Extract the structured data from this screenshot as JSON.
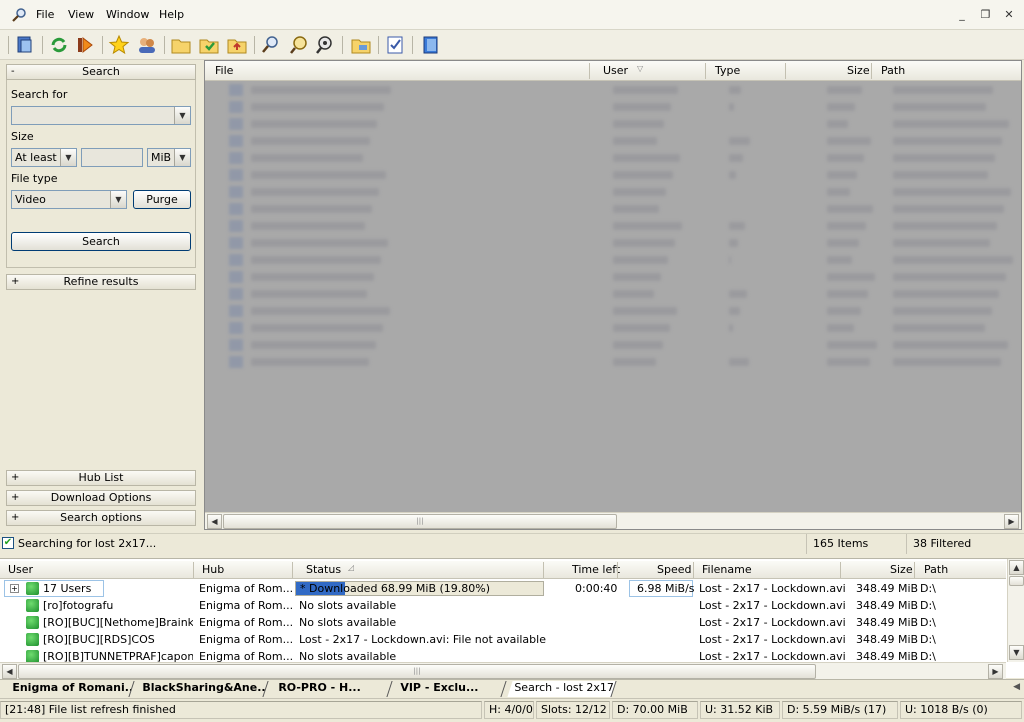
{
  "menu": {
    "items": [
      "File",
      "View",
      "Window",
      "Help"
    ]
  },
  "window_controls": {
    "minimize": "_",
    "restore": "❐",
    "close": "✕"
  },
  "left_panel": {
    "search_header": "Search",
    "search_for_label": "Search for",
    "search_for_value": "",
    "size_label": "Size",
    "size_mode": "At least",
    "size_value": "",
    "size_unit": "MiB",
    "file_type_label": "File type",
    "file_type_value": "Video",
    "purge_button": "Purge",
    "search_button": "Search",
    "refine_header": "Refine results",
    "hub_list_header": "Hub List",
    "download_options_header": "Download Options",
    "search_options_header": "Search options",
    "collapse_sign": "-",
    "expand_sign": "+"
  },
  "results": {
    "columns": [
      "File",
      "User",
      "Type",
      "Size",
      "Path"
    ],
    "row_count_visible": 17
  },
  "search_status": {
    "text": "Searching for lost 2x17...",
    "items": "165 Items",
    "filtered": "38 Filtered"
  },
  "queue": {
    "columns": [
      "User",
      "Hub",
      "Status",
      "Time left",
      "Speed",
      "Filename",
      "Size",
      "Path"
    ],
    "rows": [
      {
        "user": "17 Users",
        "hub": "Enigma of Rom...",
        "status": "* Downloaded 68.99 MiB (19.80%)",
        "progress": 0.198,
        "time_left": "0:00:40",
        "speed": "6.98 MiB/s",
        "filename": "Lost - 2x17 - Lockdown.avi",
        "size": "348.49 MiB",
        "path": "D:\\"
      },
      {
        "user": "[ro]fotografu",
        "hub": "Enigma of Rom...",
        "status": "No slots available",
        "time_left": "",
        "speed": "",
        "filename": "Lost - 2x17 - Lockdown.avi",
        "size": "348.49 MiB",
        "path": "D:\\"
      },
      {
        "user": "[RO][BUC][Nethome]Brainkiller",
        "hub": "Enigma of Rom...",
        "status": "No slots available",
        "time_left": "",
        "speed": "",
        "filename": "Lost - 2x17 - Lockdown.avi",
        "size": "348.49 MiB",
        "path": "D:\\"
      },
      {
        "user": "[RO][BUC][RDS]COS",
        "hub": "Enigma of Rom...",
        "status": "Lost - 2x17 - Lockdown.avi: File not available",
        "time_left": "",
        "speed": "",
        "filename": "Lost - 2x17 - Lockdown.avi",
        "size": "348.49 MiB",
        "path": "D:\\"
      },
      {
        "user": "[RO][B]TUNNETPRAF]capone",
        "hub": "Enigma of Rom...",
        "status": "No slots available",
        "time_left": "",
        "speed": "",
        "filename": "Lost - 2x17 - Lockdown.avi",
        "size": "348.49 MiB",
        "path": "D:\\"
      }
    ]
  },
  "tabs": [
    {
      "label": "Enigma of Romani...",
      "active": false
    },
    {
      "label": "BlackSharing&Ane...",
      "active": false
    },
    {
      "label": "RO-PRO   -   H...",
      "active": false
    },
    {
      "label": "VIP   -   Exclu...",
      "active": false
    },
    {
      "label": "Search - lost 2x17",
      "active": true
    }
  ],
  "statusbar": {
    "message": "[21:48] File list refresh finished",
    "hubs": "H: 4/0/0",
    "slots": "Slots: 12/12",
    "downloaded": "D: 70.00 MiB",
    "uploaded": "U: 31.52 KiB",
    "dl_speed": "D: 5.59 MiB/s (17)",
    "ul_speed": "U: 1018 B/s (0)"
  },
  "colors": {
    "accent": "#316ac5",
    "progress": "#316ac5",
    "results_bg": "#a9a9a9"
  }
}
